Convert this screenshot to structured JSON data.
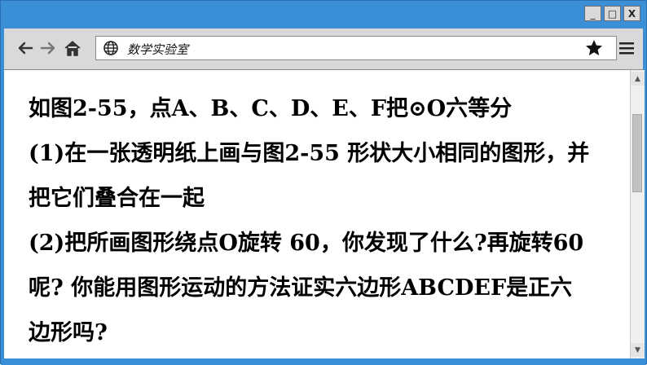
{
  "window": {
    "controls": {
      "minimize": "_",
      "maximize": "□",
      "close": "X"
    }
  },
  "toolbar": {
    "back_icon": "back-arrow-icon",
    "forward_icon": "forward-arrow-icon",
    "home_icon": "home-icon",
    "address": "数学实验室",
    "globe_icon": "globe-icon",
    "bookmark_icon": "star-icon",
    "menu_icon": "hamburger-menu-icon"
  },
  "content": {
    "lines": [
      "如图2-55，点A、B、C、D、E、F把⊙O六等分",
      "(1)在一张透明纸上画与图2-55 形状大小相同的图形，并",
      "把它们叠合在一起",
      "(2)把所画图形绕点O旋转 60，你发现了什么?再旋转60",
      "呢? 你能用图形运动的方法证实六边形ABCDEF是正六",
      "边形吗?"
    ]
  },
  "colors": {
    "frame": "#3b8fd6",
    "toolbar": "#d9d9d9",
    "page": "#ffffff"
  }
}
